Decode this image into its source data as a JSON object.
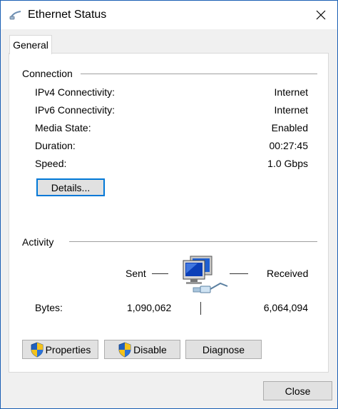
{
  "window": {
    "title": "Ethernet Status"
  },
  "tabs": [
    {
      "label": "General",
      "selected": true
    }
  ],
  "connection": {
    "heading": "Connection",
    "rows": [
      {
        "label": "IPv4 Connectivity:",
        "value": "Internet"
      },
      {
        "label": "IPv6 Connectivity:",
        "value": "Internet"
      },
      {
        "label": "Media State:",
        "value": "Enabled"
      },
      {
        "label": "Duration:",
        "value": "00:27:45"
      },
      {
        "label": "Speed:",
        "value": "1.0 Gbps"
      }
    ],
    "details_label": "Details..."
  },
  "activity": {
    "heading": "Activity",
    "sent_label": "Sent",
    "received_label": "Received",
    "bytes_label": "Bytes:",
    "bytes_sent": "1,090,062",
    "bytes_received": "6,064,094"
  },
  "buttons": {
    "properties": "Properties",
    "disable": "Disable",
    "diagnose": "Diagnose",
    "close": "Close"
  },
  "icons": {
    "title": "network-cable-icon",
    "close": "close-icon",
    "shield": "uac-shield-icon",
    "network": "network-computers-icon"
  },
  "colors": {
    "accent": "#0078d7",
    "window_border": "#1a5fb4",
    "button_face": "#e1e1e1"
  }
}
